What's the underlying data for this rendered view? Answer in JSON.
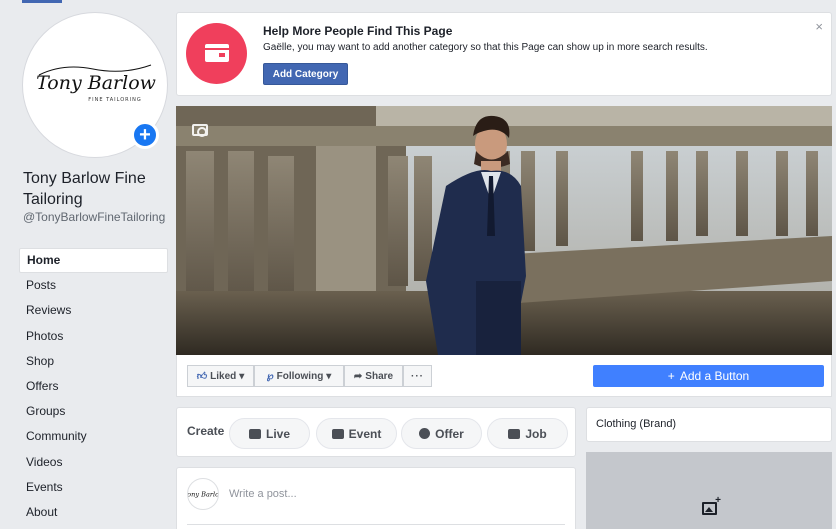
{
  "page": {
    "name": "Tony Barlow Fine Tailoring",
    "handle": "@TonyBarlowFineTailoring",
    "logo_text": "Tony Barlow",
    "logo_subtext": "FINE TAILORING"
  },
  "nav": {
    "items": [
      {
        "label": "Home",
        "active": true
      },
      {
        "label": "Posts"
      },
      {
        "label": "Reviews"
      },
      {
        "label": "Photos"
      },
      {
        "label": "Shop"
      },
      {
        "label": "Offers"
      },
      {
        "label": "Groups"
      },
      {
        "label": "Community"
      },
      {
        "label": "Videos"
      },
      {
        "label": "Events"
      },
      {
        "label": "About"
      }
    ]
  },
  "notice": {
    "title": "Help More People Find This Page",
    "text": "Gaëlle, you may want to add another category so that this Page can show up in more search results.",
    "button": "Add Category",
    "close": "×"
  },
  "actions": {
    "liked": "Liked",
    "following": "Following",
    "share": "Share",
    "more": "···",
    "add_button": "Add a Button"
  },
  "create": {
    "label": "Create",
    "live": "Live",
    "event": "Event",
    "offer": "Offer",
    "job": "Job"
  },
  "post": {
    "placeholder": "Write a post..."
  },
  "sidebar": {
    "category": "Clothing (Brand)"
  },
  "colors": {
    "brand_blue": "#4267b2",
    "cta_blue": "#4080ff",
    "notice_pink": "#f03f5c"
  }
}
